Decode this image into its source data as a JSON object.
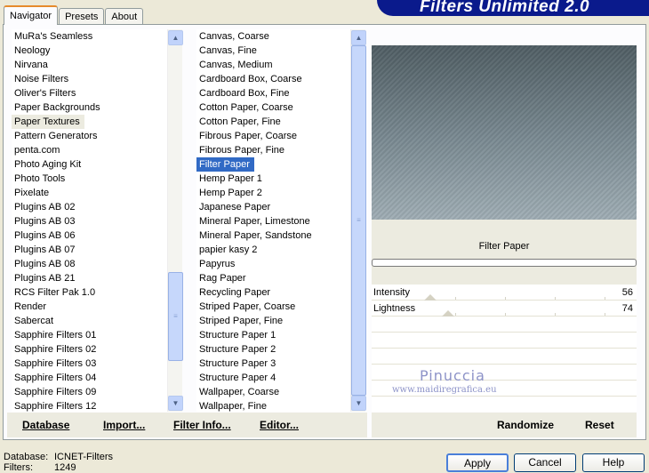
{
  "tabs": [
    "Navigator",
    "Presets",
    "About"
  ],
  "banner_title": "Filters Unlimited 2.0",
  "categories": [
    "MuRa's Seamless",
    "Neology",
    "Nirvana",
    "Noise Filters",
    "Oliver's Filters",
    "Paper Backgrounds",
    "Paper Textures",
    "Pattern Generators",
    "penta.com",
    "Photo Aging Kit",
    "Photo Tools",
    "Pixelate",
    "Plugins AB 02",
    "Plugins AB 03",
    "Plugins AB 06",
    "Plugins AB 07",
    "Plugins AB 08",
    "Plugins AB 21",
    "RCS Filter Pak 1.0",
    "Render",
    "Sabercat",
    "Sapphire Filters 01",
    "Sapphire Filters 02",
    "Sapphire Filters 03",
    "Sapphire Filters 04",
    "Sapphire Filters 09",
    "Sapphire Filters 12"
  ],
  "selected_category": "Paper Textures",
  "filters": [
    "Canvas, Coarse",
    "Canvas, Fine",
    "Canvas, Medium",
    "Cardboard Box, Coarse",
    "Cardboard Box, Fine",
    "Cotton Paper, Coarse",
    "Cotton Paper, Fine",
    "Fibrous Paper, Coarse",
    "Fibrous Paper, Fine",
    "Filter Paper",
    "Hemp Paper 1",
    "Hemp Paper 2",
    "Japanese Paper",
    "Mineral Paper, Limestone",
    "Mineral Paper, Sandstone",
    "papier kasy 2",
    "Papyrus",
    "Rag Paper",
    "Recycling Paper",
    "Striped Paper, Coarse",
    "Striped Paper, Fine",
    "Structure Paper 1",
    "Structure Paper 2",
    "Structure Paper 3",
    "Structure Paper 4",
    "Wallpaper, Coarse",
    "Wallpaper, Fine"
  ],
  "selected_filter": "Filter Paper",
  "current_filter_name": "Filter Paper",
  "params": [
    {
      "label": "Intensity",
      "value": "56",
      "level": 0.22
    },
    {
      "label": "Lightness",
      "value": "74",
      "level": 0.29
    }
  ],
  "watermark": {
    "line1": "Pinuccia",
    "line2": "www.maidiregrafica.eu"
  },
  "left_buttons": {
    "database": "Database",
    "import": "Import...",
    "filter_info": "Filter Info...",
    "editor": "Editor..."
  },
  "right_buttons": {
    "randomize": "Randomize",
    "reset": "Reset"
  },
  "status": {
    "database_label": "Database:",
    "database_value": "ICNET-Filters",
    "filters_label": "Filters:",
    "filters_value": "1249"
  },
  "dialog_buttons": {
    "apply": "Apply",
    "cancel": "Cancel",
    "help": "Help"
  }
}
